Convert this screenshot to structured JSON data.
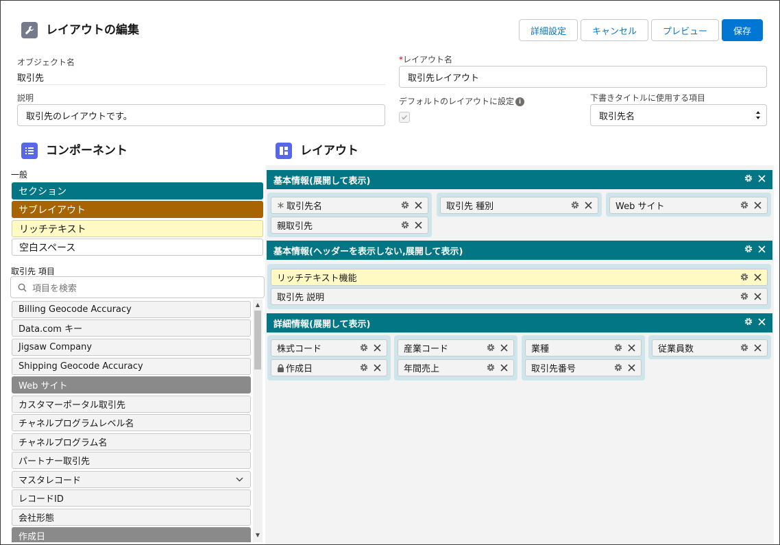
{
  "header": {
    "title": "レイアウトの編集",
    "buttons": {
      "advanced": "詳細設定",
      "cancel": "キャンセル",
      "preview": "プレビュー",
      "save": "保存"
    }
  },
  "form": {
    "object_label": "オブジェクト名",
    "object_value": "取引先",
    "layout_name_label": "レイアウト名",
    "layout_name_value": "取引先レイアウト",
    "description_label": "説明",
    "description_value": "取引先のレイアウトです。",
    "default_label": "デフォルトのレイアウトに設定",
    "draft_title_label": "下書きタイトルに使用する項目",
    "draft_title_value": "取引先名"
  },
  "components": {
    "title": "コンポーネント",
    "general_label": "一般",
    "general": [
      "セクション",
      "サブレイアウト",
      "リッチテキスト",
      "空白スペース"
    ],
    "fields_label": "取引先 項目",
    "search_placeholder": "項目を検索",
    "fields": [
      "Billing Geocode Accuracy",
      "Data.com キー",
      "Jigsaw Company",
      "Shipping Geocode Accuracy",
      "Web サイト",
      "カスタマーポータル取引先",
      "チャネルプログラムレベル名",
      "チャネルプログラム名",
      "パートナー取引先",
      "マスタレコード",
      "レコードID",
      "会社形態",
      "作成日"
    ],
    "used_fields": [
      "Web サイト",
      "作成日"
    ]
  },
  "layout": {
    "title": "レイアウト",
    "sections": [
      {
        "title": "基本情報(展開して表示)",
        "columns": [
          [
            "取引先名",
            "親取引先"
          ],
          [
            "取引先 種別"
          ],
          [
            "Web サイト"
          ]
        ]
      },
      {
        "title": "基本情報(ヘッダーを表示しない,展開して表示)",
        "columns": [
          [
            "リッチテキスト機能",
            "取引先 説明"
          ]
        ]
      },
      {
        "title": "詳細情報(展開して表示)",
        "columns": [
          [
            "株式コード",
            "作成日"
          ],
          [
            "産業コード",
            "年間売上"
          ],
          [
            "業種",
            "取引先番号"
          ],
          [
            "従業員数"
          ]
        ]
      }
    ]
  },
  "colors": {
    "brand": "#0176d3",
    "section_bar": "#027684",
    "subsection": "#a86403",
    "rich_text": "#fff9c4",
    "used_field": "#8a8a8a",
    "column_bg": "#cfe5ec"
  }
}
